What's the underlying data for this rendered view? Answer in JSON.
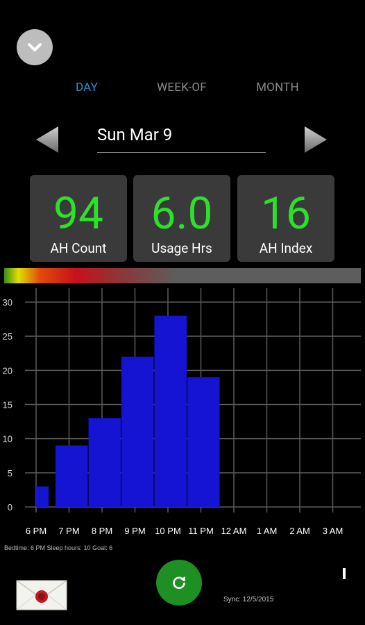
{
  "tabs": [
    {
      "label": "DAY",
      "active": true
    },
    {
      "label": "WEEK-OF",
      "active": false
    },
    {
      "label": "MONTH",
      "active": false
    }
  ],
  "date_nav": {
    "label": "Sun Mar 9"
  },
  "metrics": [
    {
      "value": "94",
      "label": "AH Count"
    },
    {
      "value": "6.0",
      "label": "Usage Hrs"
    },
    {
      "value": "16",
      "label": "AH Index"
    }
  ],
  "chart_data": {
    "type": "bar",
    "categories": [
      "6 PM",
      "7 PM",
      "8 PM",
      "9 PM",
      "10 PM",
      "11 PM",
      "12 AM",
      "1 AM",
      "2 AM",
      "3 AM"
    ],
    "values": [
      3,
      9,
      13,
      22,
      28,
      19,
      null,
      null,
      null,
      null
    ],
    "yticks": [
      "0",
      "5",
      "10",
      "15",
      "20",
      "25",
      "30"
    ],
    "ylim": [
      0,
      30
    ],
    "grid": true,
    "bar_color": "#1414d2",
    "title": "",
    "xlabel": "",
    "ylabel": ""
  },
  "footer": {
    "info": "Bedtime: 6 PM   Sleep hours: 10  Goal: 6",
    "sync": "Sync: 12/5/2015"
  },
  "icons": {
    "collapse": "chevron-down-icon",
    "prev": "arrow-left-icon",
    "next": "arrow-right-icon",
    "refresh": "refresh-icon",
    "mail": "envelope-icon"
  },
  "colors": {
    "accent_tab": "#2f8fd0",
    "metric_value": "#2ce02c",
    "refresh_button": "#1e8f22"
  }
}
